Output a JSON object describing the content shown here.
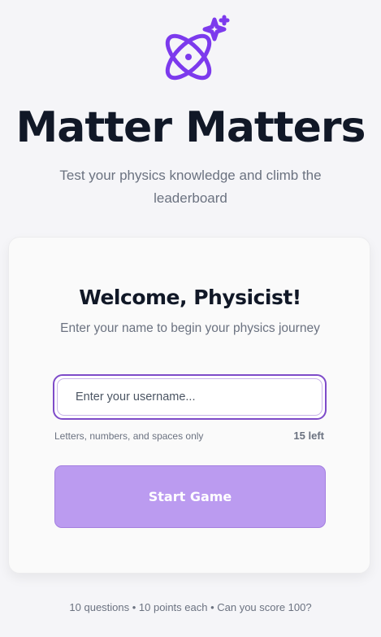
{
  "logo": {
    "icon": "atom-sparkle-icon",
    "color": "#7c3aed"
  },
  "header": {
    "title": "Matter Matters",
    "subtitle": "Test your physics knowledge and climb the leaderboard"
  },
  "card": {
    "title": "Welcome, Physicist!",
    "subtitle": "Enter your name to begin your physics journey",
    "username": {
      "placeholder": "Enter your username...",
      "value": "",
      "hint": "Letters, numbers, and spaces only",
      "remaining": "15 left"
    },
    "start_button_label": "Start Game"
  },
  "footer": {
    "note": "10 questions • 10 points each • Can you score 100?"
  },
  "colors": {
    "accent": "#7c3aed",
    "button": "#bb9bf0",
    "text_dark": "#111827",
    "text_muted": "#6b7280"
  }
}
